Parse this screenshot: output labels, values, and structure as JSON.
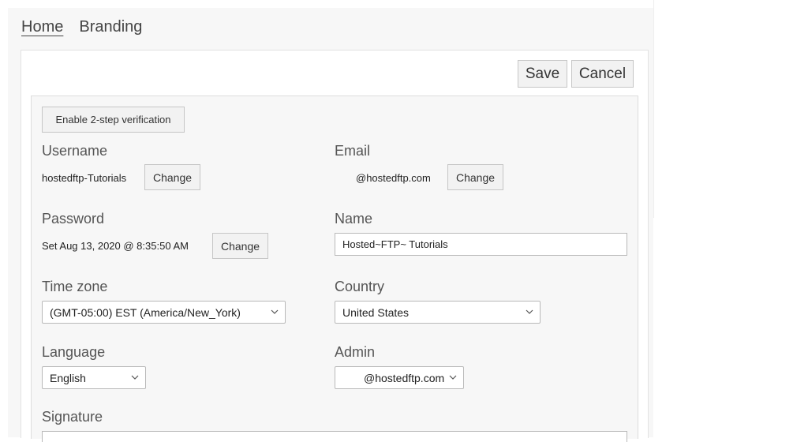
{
  "tabs": [
    {
      "label": "Home",
      "active": true
    },
    {
      "label": "Branding",
      "active": false
    }
  ],
  "toolbar": {
    "save_label": "Save",
    "cancel_label": "Cancel"
  },
  "security": {
    "enable_2step_label": "Enable 2-step verification"
  },
  "username": {
    "label": "Username",
    "value": "hostedftp-Tutorials",
    "change_label": "Change"
  },
  "email": {
    "label": "Email",
    "value": "@hostedftp.com",
    "change_label": "Change"
  },
  "password": {
    "label": "Password",
    "value": "Set Aug 13, 2020 @ 8:35:50 AM",
    "change_label": "Change"
  },
  "name": {
    "label": "Name",
    "value": "Hosted~FTP~ Tutorials"
  },
  "timezone": {
    "label": "Time zone",
    "selected": "(GMT-05:00) EST (America/New_York)"
  },
  "country": {
    "label": "Country",
    "selected": "United States"
  },
  "language": {
    "label": "Language",
    "selected": "English"
  },
  "admin": {
    "label": "Admin",
    "selected": "@hostedftp.com"
  },
  "signature": {
    "label": "Signature"
  },
  "icons": {
    "chevron": "chevron-down-icon"
  }
}
